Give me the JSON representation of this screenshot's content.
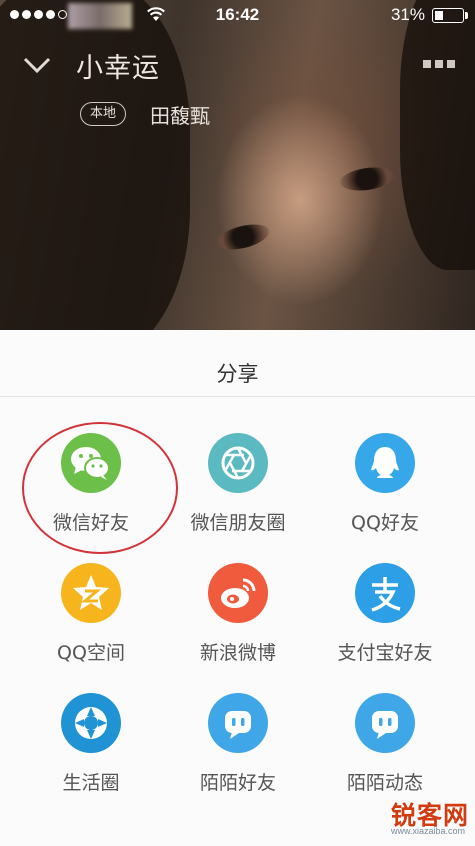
{
  "status_bar": {
    "time": "16:42",
    "battery_percent": "31%",
    "battery_level": 0.31,
    "signal_bars": 5,
    "signal_filled": 4
  },
  "player": {
    "song_title": "小幸运",
    "quality_badge": "本地",
    "artist": "田馥甄"
  },
  "share_sheet": {
    "title": "分享",
    "items": [
      {
        "label": "微信好友",
        "icon": "wechat-icon",
        "color": "#6cc04a"
      },
      {
        "label": "微信朋友圈",
        "icon": "wechat-moments-icon",
        "color": "#5ab9c1"
      },
      {
        "label": "QQ好友",
        "icon": "qq-icon",
        "color": "#36a8ea"
      },
      {
        "label": "QQ空间",
        "icon": "qzone-icon",
        "color": "#f6b51d"
      },
      {
        "label": "新浪微博",
        "icon": "weibo-icon",
        "color": "#f05a3d"
      },
      {
        "label": "支付宝好友",
        "icon": "alipay-icon",
        "color": "#2c9fe6"
      },
      {
        "label": "生活圈",
        "icon": "life-circle-icon",
        "color": "#1f93d4"
      },
      {
        "label": "陌陌好友",
        "icon": "momo-icon",
        "color": "#3fa7e8"
      },
      {
        "label": "陌陌动态",
        "icon": "momo-feed-icon",
        "color": "#3fa7e8"
      }
    ]
  },
  "watermark": {
    "text": "锐客网",
    "url": "www.xiazaiba.com"
  }
}
